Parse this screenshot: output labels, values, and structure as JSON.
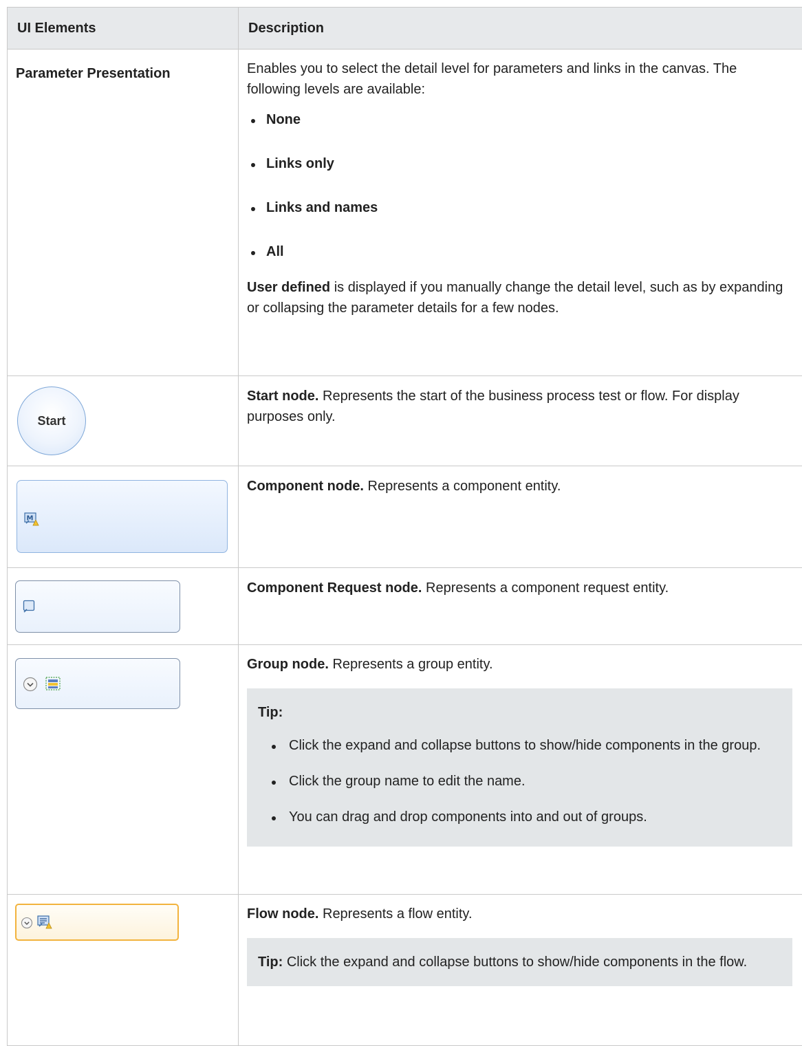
{
  "table": {
    "header": {
      "col1": "UI Elements",
      "col2": "Description"
    },
    "rows": {
      "param": {
        "name": "Parameter Presentation",
        "intro": "Enables you to select the detail level for parameters and links in the canvas. The following levels are available:",
        "levels": [
          "None",
          "Links only",
          "Links and names",
          "All"
        ],
        "outro_bold": "User defined",
        "outro_rest": " is displayed if you manually change the detail level, such as by expanding or collapsing the parameter details for a few nodes."
      },
      "start": {
        "node_label": "Start",
        "bold": "Start node.",
        "rest": " Represents the start of the business process test or flow. For display purposes only."
      },
      "component": {
        "bold": "Component node.",
        "rest": " Represents a component entity."
      },
      "request": {
        "bold": "Component Request node.",
        "rest": " Represents a component request entity."
      },
      "group": {
        "bold": "Group node.",
        "rest": " Represents a group entity.",
        "tip_label": "Tip:",
        "tips": [
          "Click the expand and collapse buttons to show/hide components in the group.",
          "Click the group name to edit the name.",
          "You can drag and drop components into and out of groups."
        ]
      },
      "flow": {
        "bold": "Flow node.",
        "rest": " Represents a flow entity.",
        "tip_label": "Tip:",
        "tip_text": " Click the expand and collapse buttons to show/hide components in the flow."
      }
    }
  }
}
